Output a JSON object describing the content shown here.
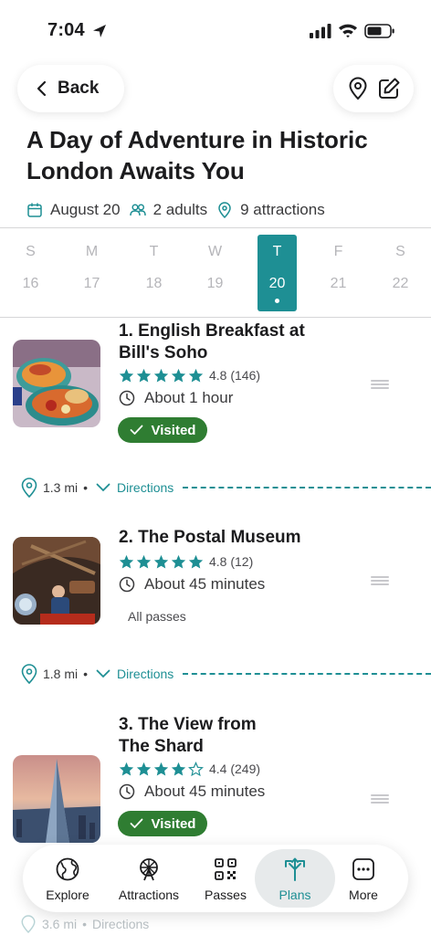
{
  "status_bar": {
    "time": "7:04"
  },
  "header": {
    "back_label": "Back"
  },
  "trip": {
    "title": "A Day of Adventure in Historic London Awaits You",
    "date": "August 20",
    "guests": "2 adults",
    "attractions": "9 attractions"
  },
  "week": [
    {
      "dow": "S",
      "num": "16"
    },
    {
      "dow": "M",
      "num": "17"
    },
    {
      "dow": "T",
      "num": "18"
    },
    {
      "dow": "W",
      "num": "19"
    },
    {
      "dow": "T",
      "num": "20",
      "selected": true
    },
    {
      "dow": "F",
      "num": "21"
    },
    {
      "dow": "S",
      "num": "22"
    }
  ],
  "stops": [
    {
      "name_line1": "1. English Breakfast at",
      "name_line2": "Bill's Soho",
      "rating": 4.8,
      "rating_text": "4.8 (146)",
      "duration": "About 1 hour",
      "visited_label": "Visited"
    },
    {
      "name_line1": "2. The Postal Museum",
      "rating": 4.8,
      "rating_text": "4.8 (12)",
      "duration": "About 45 minutes",
      "passes_label": "All passes"
    },
    {
      "name_line1": "3. The View from",
      "name_line2": "The Shard",
      "rating": 4.4,
      "rating_text": "4.4 (249)",
      "duration": "About 45 minutes",
      "visited_label": "Visited"
    }
  ],
  "distances": [
    {
      "distance": "1.3 mi",
      "bullet": "•",
      "directions_label": "Directions"
    },
    {
      "distance": "1.8 mi",
      "bullet": "•",
      "directions_label": "Directions"
    },
    {
      "distance": "3.6 mi",
      "bullet": "•",
      "directions_label": "Directions"
    }
  ],
  "bottom_nav": [
    {
      "label": "Explore",
      "icon": "globe-icon"
    },
    {
      "label": "Attractions",
      "icon": "ferris-wheel-icon"
    },
    {
      "label": "Passes",
      "icon": "qr-code-icon"
    },
    {
      "label": "Plans",
      "icon": "plans-arrows-icon",
      "active": true
    },
    {
      "label": "More",
      "icon": "more-dots-icon"
    }
  ],
  "colors": {
    "accent": "#1e8f94",
    "visited_green": "#2f7d32",
    "star": "#1e8f94"
  }
}
